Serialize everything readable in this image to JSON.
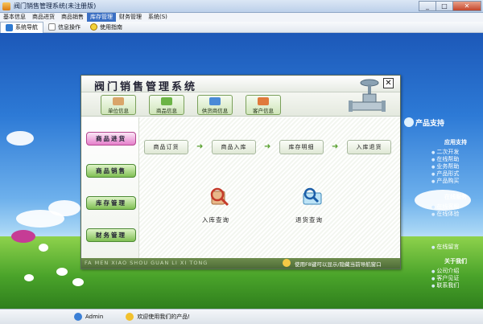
{
  "window": {
    "title": "阀门销售管理系统(未注册版)",
    "buttons": [
      "_",
      "□",
      "✕"
    ]
  },
  "menubar": {
    "items": [
      "基本信息",
      "商品进货",
      "商品销售",
      "库存管理",
      "财务管理",
      "系统(S)"
    ],
    "active_index": 3
  },
  "toolbar": {
    "items": [
      {
        "label": "系统导航",
        "icon": "nav-icon"
      },
      {
        "label": "信息操作",
        "icon": "info-icon"
      },
      {
        "label": "使用指南",
        "icon": "help-icon"
      }
    ]
  },
  "dialog": {
    "title": "阀门销售管理系统",
    "close": "✕",
    "top_buttons": [
      "单位信息",
      "商品信息",
      "供货商信息",
      "客户信息"
    ],
    "side_buttons": [
      "商品进货",
      "商品销售",
      "库存管理",
      "财务管理"
    ],
    "side_active_index": 0,
    "flow": [
      "商品订货",
      "商品入库",
      "库存明细",
      "入库退货"
    ],
    "queries": [
      "入库查询",
      "退货查询"
    ],
    "pinyin": "FA MEN XIAO SHOU GUAN LI XI TONG",
    "hint": "使用F8键可以显示/隐藏当前导航窗口"
  },
  "support": {
    "header": "产品支持",
    "sections": [
      {
        "title": "应用支持",
        "links": [
          "二次开发",
          "在线帮助",
          "业务帮助",
          "产品形式",
          "产品购买"
        ]
      },
      {
        "title": "在线服务",
        "links": [
          "在线客服",
          "在线体验",
          "在线留言"
        ]
      },
      {
        "title": "关于我们",
        "links": [
          "公司介绍",
          "客户见证",
          "联系我们"
        ]
      }
    ]
  },
  "statusbar": {
    "user": "Admin",
    "welcome": "欢迎使用我们的产品!"
  }
}
